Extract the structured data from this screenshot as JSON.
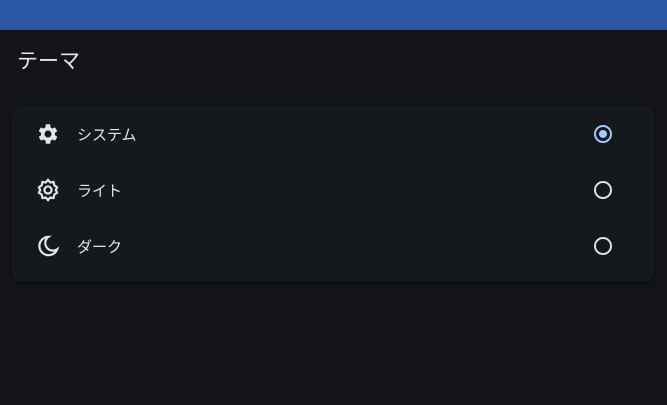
{
  "header": {
    "title": "テーマ"
  },
  "theme_options": [
    {
      "label": "システム",
      "icon": "gear-filled-icon",
      "selected": true
    },
    {
      "label": "ライト",
      "icon": "gear-outline-icon",
      "selected": false
    },
    {
      "label": "ダーク",
      "icon": "moon-icon",
      "selected": false
    }
  ],
  "colors": {
    "accent": "#a4c8ff",
    "topbar": "#2a56a4",
    "background": "#121419"
  }
}
